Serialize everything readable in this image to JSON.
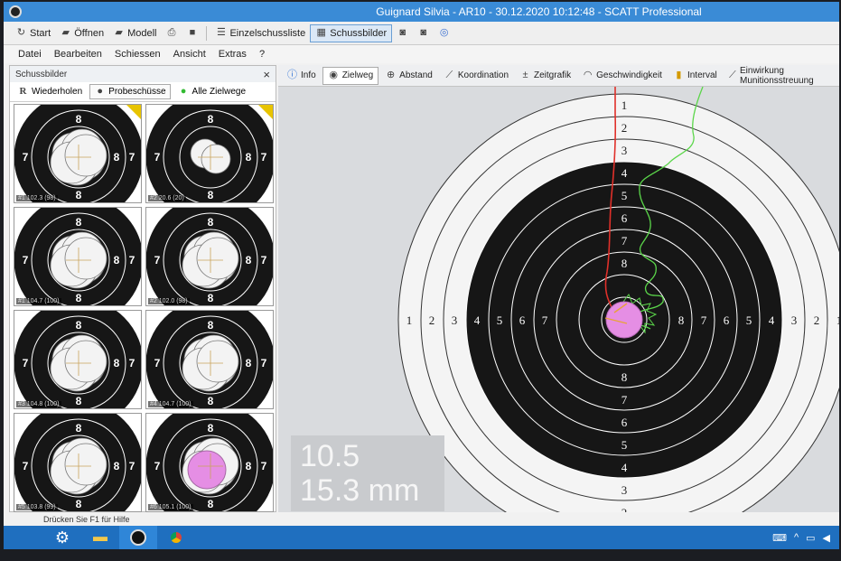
{
  "window": {
    "title": "Guignard Silvia - AR10 - 30.12.2020 10:12:48 - SCATT Professional"
  },
  "toolbar": {
    "start": "Start",
    "open": "Öffnen",
    "model": "Modell",
    "single_shot_list": "Einzelschussliste",
    "shot_images": "Schussbilder"
  },
  "menu": [
    "Datei",
    "Bearbeiten",
    "Schiessen",
    "Ansicht",
    "Extras",
    "?"
  ],
  "left_panel": {
    "title": "Schussbilder",
    "close": "×",
    "tabs": [
      "Wiederholen",
      "Probeschüsse",
      "Alle Zielwege"
    ],
    "thumbnails": [
      {
        "caption": "#1 102.3 (98)",
        "flag": true
      },
      {
        "caption": "#2 20.6 (20)",
        "flag": true
      },
      {
        "caption": "#1 104.7 (100)",
        "flag": false
      },
      {
        "caption": "#2 102.0 (98)",
        "flag": false
      },
      {
        "caption": "#3 104.8 (100)",
        "flag": false
      },
      {
        "caption": "#4 104.7 (100)",
        "flag": false
      },
      {
        "caption": "#5 103.8 (99)",
        "flag": false
      },
      {
        "caption": "#6 105.1 (100)",
        "flag": false
      }
    ]
  },
  "right_panel": {
    "tabs": [
      "Info",
      "Zielweg",
      "Abstand",
      "Koordination",
      "Zeitgrafik",
      "Geschwindigkeit",
      "Interval",
      "Einwirkung Munitionsstreuung"
    ],
    "selected_tab": 1,
    "score": "10.5",
    "distance": "15.3 mm",
    "ring_labels": [
      "1",
      "2",
      "3",
      "4",
      "5",
      "6",
      "7",
      "8"
    ]
  },
  "status": {
    "hint": "Drücken Sie F1 für Hilfe"
  },
  "colors": {
    "trace_red": "#e0302a",
    "trace_green": "#5bd64a",
    "shot": "#e58ee4",
    "target_black": "#161616"
  }
}
